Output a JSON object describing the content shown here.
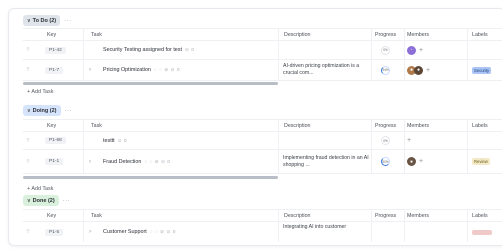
{
  "colors": {
    "todo_pill": "#dfe3ea",
    "doing_pill": "#d6e4fb",
    "done_pill": "#d8f0dc",
    "security_label": "#a9c4f5",
    "review_label": "#f3e9c6"
  },
  "columns": {
    "key": "Key",
    "task": "Task",
    "description": "Description",
    "progress": "Progress",
    "members": "Members",
    "labels": "Labels"
  },
  "add_task_label": "+ Add Task",
  "more_icon": "···",
  "groups": [
    {
      "title": "To Do (2)",
      "rows": [
        {
          "key": "P1-42",
          "task": "Security Testing assigned for test",
          "icons": "⊙ 0",
          "description": "",
          "progress": "0%",
          "members": [
            "purple-avatar"
          ],
          "label": ""
        },
        {
          "key": "P1-7",
          "task": "Pricing Optimization",
          "icons": "◌ ◌ ⊘ ⊙ 0",
          "description": "AI-driven pricing optimization is a crucial com...",
          "progress": "34%",
          "members": [
            "photo-avatar-a",
            "photo-avatar-b"
          ],
          "label": "Security"
        }
      ]
    },
    {
      "title": "Doing (2)",
      "rows": [
        {
          "key": "P1-68",
          "task": "testtt",
          "icons": "⊙ 0",
          "description": "",
          "progress": "0%",
          "members": [],
          "label": ""
        },
        {
          "key": "P1-1",
          "task": "Fraud Detection",
          "icons": "◌ ◌ ⊘ ⊙ 0",
          "description": "Implementing fraud detection in an AI shopping ...",
          "progress": "50%",
          "members": [
            "photo-avatar-c"
          ],
          "label": "Review"
        }
      ]
    },
    {
      "title": "Done (2)",
      "rows": [
        {
          "key": "P1-5",
          "task": "Customer Support",
          "icons": "◌ ◌ ⊘ ⊙ 0",
          "description": "Integrating AI into customer",
          "progress": "",
          "members": [],
          "label": ""
        }
      ]
    }
  ]
}
